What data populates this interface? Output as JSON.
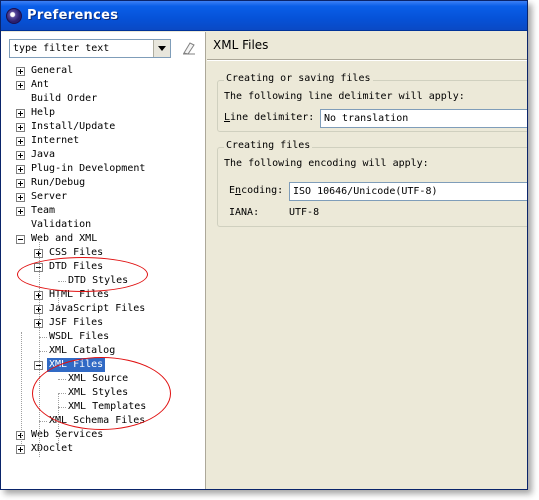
{
  "window": {
    "title": "Preferences"
  },
  "filter": {
    "value": "type filter text"
  },
  "tree": {
    "items": [
      {
        "label": "General",
        "toggle": "plus"
      },
      {
        "label": "Ant",
        "toggle": "plus"
      },
      {
        "label": "Build Order",
        "toggle": "none"
      },
      {
        "label": "Help",
        "toggle": "plus"
      },
      {
        "label": "Install/Update",
        "toggle": "plus"
      },
      {
        "label": "Internet",
        "toggle": "plus"
      },
      {
        "label": "Java",
        "toggle": "plus"
      },
      {
        "label": "Plug-in Development",
        "toggle": "plus"
      },
      {
        "label": "Run/Debug",
        "toggle": "plus"
      },
      {
        "label": "Server",
        "toggle": "plus"
      },
      {
        "label": "Team",
        "toggle": "plus"
      },
      {
        "label": "Validation",
        "toggle": "none"
      },
      {
        "label": "Web and XML",
        "toggle": "minus"
      },
      {
        "label": "CSS Files",
        "toggle": "plus"
      },
      {
        "label": "DTD Files",
        "toggle": "minus"
      },
      {
        "label": "DTD Styles",
        "toggle": "none"
      },
      {
        "label": "HTML Files",
        "toggle": "plus"
      },
      {
        "label": "JavaScript Files",
        "toggle": "plus"
      },
      {
        "label": "JSF Files",
        "toggle": "plus"
      },
      {
        "label": "WSDL Files",
        "toggle": "none"
      },
      {
        "label": "XML Catalog",
        "toggle": "none"
      },
      {
        "label": "XML Files",
        "toggle": "minus"
      },
      {
        "label": "XML Source",
        "toggle": "none"
      },
      {
        "label": "XML Styles",
        "toggle": "none"
      },
      {
        "label": "XML Templates",
        "toggle": "none"
      },
      {
        "label": "XML Schema Files",
        "toggle": "none"
      },
      {
        "label": "Web Services",
        "toggle": "plus"
      },
      {
        "label": "XDoclet",
        "toggle": "plus"
      }
    ]
  },
  "page": {
    "title": "XML Files",
    "group1": {
      "title": "Creating or saving files",
      "desc": "The following line delimiter will apply:",
      "delimiter_label_u": "L",
      "delimiter_label_rest": "ine delimiter:",
      "delimiter_value": "No translation"
    },
    "group2": {
      "title": "Creating files",
      "desc": "The following encoding will apply:",
      "encoding_label_pre": "E",
      "encoding_label_u": "n",
      "encoding_label_rest": "coding:",
      "encoding_value": "ISO 10646/Unicode(UTF-8)",
      "iana_label": "IANA:",
      "iana_value": "UTF-8"
    }
  },
  "colors": {
    "selection": "#316ac5",
    "annotation": "#e01010",
    "titlebar": "#0a5ee8"
  }
}
